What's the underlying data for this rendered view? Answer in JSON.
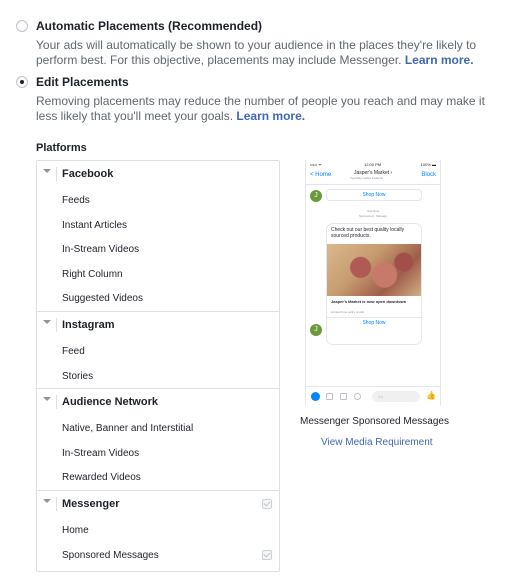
{
  "placements": {
    "automatic": {
      "title": "Automatic Placements (Recommended)",
      "desc": "Your ads will automatically be shown to your audience in the places they're likely to perform best. For this objective, placements may include Messenger.",
      "link": "Learn more.",
      "selected": false
    },
    "edit": {
      "title": "Edit Placements",
      "desc": "Removing placements may reduce the number of people you reach and may make it less likely that you'll meet your goals.",
      "link": "Learn more.",
      "selected": true
    }
  },
  "platforms": {
    "label": "Platforms",
    "facebook": {
      "name": "Facebook",
      "items": [
        "Feeds",
        "Instant Articles",
        "In-Stream Videos",
        "Right Column",
        "Suggested Videos"
      ]
    },
    "instagram": {
      "name": "Instagram",
      "items": [
        "Feed",
        "Stories"
      ]
    },
    "audience_network": {
      "name": "Audience Network",
      "items": [
        "Native, Banner and Interstitial",
        "In-Stream Videos",
        "Rewarded Videos"
      ]
    },
    "messenger": {
      "name": "Messenger",
      "items": [
        "Home",
        "Sponsored Messages"
      ]
    }
  },
  "preview": {
    "status": {
      "signal": "••••• ᯤ",
      "time": "12:00 PM",
      "battery": "100% ▬"
    },
    "nav": {
      "back": "< Home",
      "title": "Jasper's Market ›",
      "subtitle": "Typically replies instantly",
      "block": "Block"
    },
    "avatar_letter": "J",
    "shop_now": "Shop Now",
    "meta_time": "Just Now",
    "meta_sponsored": "Sponsored · Manage",
    "message": "Check out our best quality locally sourced products.",
    "card_title": "Jasper's Market is now open downtown",
    "card_subtitle": "Limited time sultry snack",
    "composer_placeholder": "Aa",
    "caption": "Messenger Sponsored Messages",
    "media_link": "View Media Requirement"
  }
}
